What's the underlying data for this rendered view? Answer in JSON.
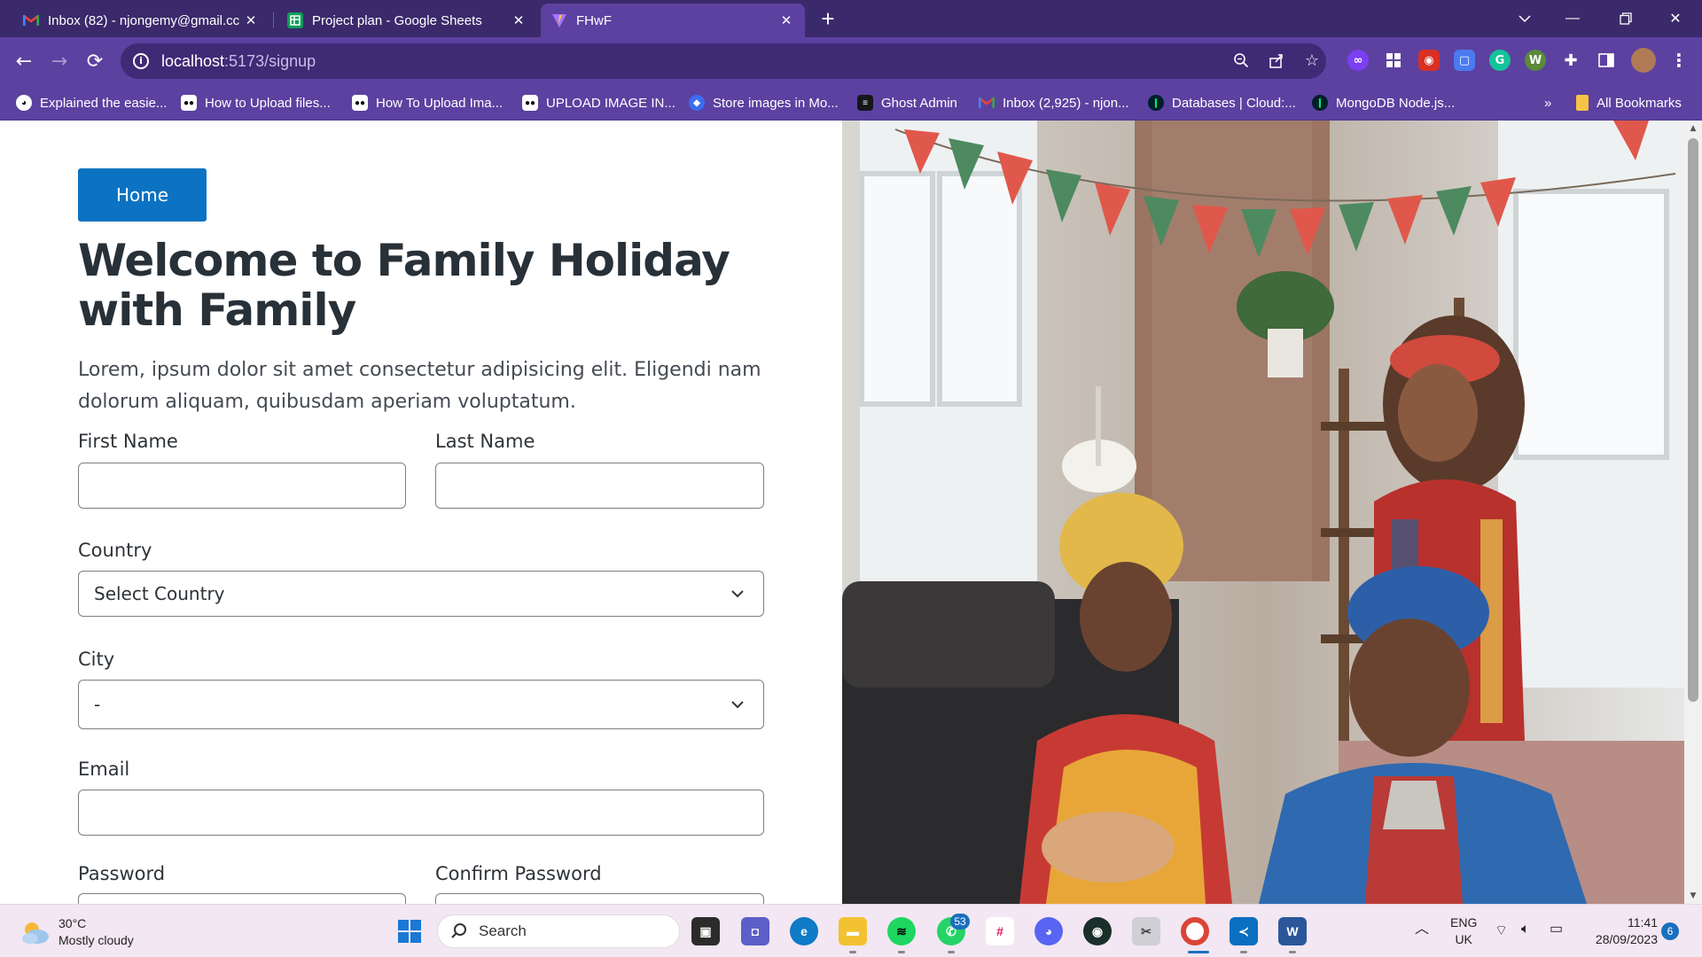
{
  "browser": {
    "tabs": [
      {
        "title": "Inbox (82) - njongemy@gmail.cc",
        "icon": "gmail-icon",
        "color": "#ea4335"
      },
      {
        "title": "Project plan - Google Sheets",
        "icon": "sheets-icon",
        "color": "#0f9d58"
      },
      {
        "title": "FHwF",
        "icon": "vite-icon",
        "color": "#bd34fe",
        "active": true
      }
    ],
    "url_host": "localhost",
    "url_path": ":5173/signup",
    "bookmarks": [
      {
        "label": "Explained the easie...",
        "icon": "github-icon"
      },
      {
        "label": "How to Upload files...",
        "icon": "medium-icon"
      },
      {
        "label": "How To Upload Ima...",
        "icon": "medium-icon"
      },
      {
        "label": "UPLOAD IMAGE IN...",
        "icon": "medium-icon"
      },
      {
        "label": "Store images in Mo...",
        "icon": "site-icon"
      },
      {
        "label": "Ghost Admin",
        "icon": "ghost-icon"
      },
      {
        "label": "Inbox (2,925) - njon...",
        "icon": "gmail-icon"
      },
      {
        "label": "Databases | Cloud:...",
        "icon": "mongodb-icon"
      },
      {
        "label": "MongoDB Node.js...",
        "icon": "mongodb-icon"
      }
    ],
    "overflow_label": "»",
    "all_bookmarks_label": "All Bookmarks"
  },
  "page": {
    "home_label": "Home",
    "title": "Welcome to Family Holiday with Family",
    "lead": "Lorem, ipsum dolor sit amet consectetur adipisicing elit. Eligendi nam dolorum aliquam, quibusdam aperiam voluptatum.",
    "form": {
      "first_name_label": "First Name",
      "last_name_label": "Last Name",
      "country_label": "Country",
      "country_value": "Select Country",
      "city_label": "City",
      "city_value": "-",
      "email_label": "Email",
      "password_label": "Password",
      "confirm_password_label": "Confirm Password"
    }
  },
  "taskbar": {
    "temperature": "30°C",
    "weather": "Mostly cloudy",
    "search_label": "Search",
    "whatsapp_badge": "53",
    "lang": "ENG",
    "region": "UK",
    "time": "11:41",
    "date": "28/09/2023",
    "notifications": "6"
  }
}
